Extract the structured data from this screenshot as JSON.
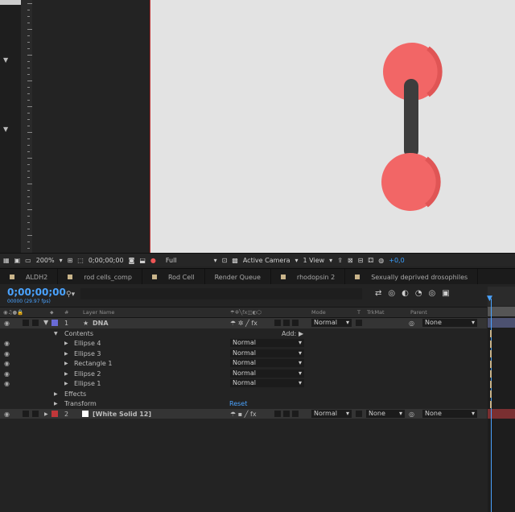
{
  "viewer_toolbar": {
    "zoom": "200%",
    "timecode": "0;00;00;00",
    "resolution": "Full",
    "camera": "Active Camera",
    "views": "1 View",
    "exposure": "+0,0"
  },
  "tabs": [
    {
      "label": "ALDH2"
    },
    {
      "label": "rod cells_comp"
    },
    {
      "label": "Rod Cell"
    },
    {
      "label": "Render Queue"
    },
    {
      "label": "rhodopsin 2"
    },
    {
      "label": "Sexually deprived drosophiles"
    }
  ],
  "timeline": {
    "timecode": "0;00;00;00",
    "fps": "00000 (29.97 fps)",
    "search_icon": "magnifier-icon",
    "columns": {
      "layer_name": "Layer Name",
      "mode": "Mode",
      "t": "T",
      "trkmat": "TrkMat",
      "parent": "Parent",
      "number": "#"
    },
    "layers": [
      {
        "num": "1",
        "name": "DNA",
        "mode": "Normal",
        "parent": "None",
        "label_color": "#6a6bd6"
      },
      {
        "num": "2",
        "name": "[White Solid 12]",
        "mode": "Normal",
        "trkmat": "None",
        "parent": "None",
        "label_color": "#c0373a"
      }
    ],
    "contents_label": "Contents",
    "add_label": "Add:",
    "shape_items": [
      {
        "name": "Ellipse 4",
        "mode": "Normal"
      },
      {
        "name": "Ellipse 3",
        "mode": "Normal"
      },
      {
        "name": "Rectangle 1",
        "mode": "Normal"
      },
      {
        "name": "Ellipse 2",
        "mode": "Normal"
      },
      {
        "name": "Ellipse 1",
        "mode": "Normal"
      }
    ],
    "effects_label": "Effects",
    "transform_label": "Transform",
    "reset_label": "Reset"
  },
  "colors": {
    "accent": "#4aa3ff",
    "ball": "#f26666",
    "rod": "#3d3d3d",
    "viewer_bg": "#e3e3e3"
  }
}
